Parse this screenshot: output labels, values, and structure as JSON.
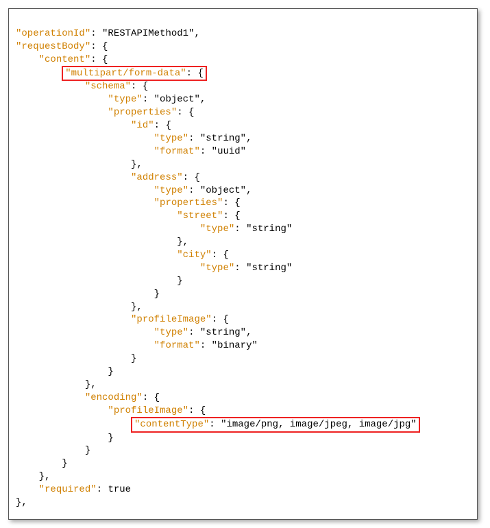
{
  "lines": {
    "l1_k": "\"operationId\"",
    "l1_v": "\"RESTAPIMethod1\"",
    "l2_k": "\"requestBody\"",
    "l3_k": "\"content\"",
    "l4_k": "\"multipart/form-data\"",
    "l5_k": "\"schema\"",
    "l6_k": "\"type\"",
    "l6_v": "\"object\"",
    "l7_k": "\"properties\"",
    "l8_k": "\"id\"",
    "l9_k": "\"type\"",
    "l9_v": "\"string\"",
    "l10_k": "\"format\"",
    "l10_v": "\"uuid\"",
    "l12_k": "\"address\"",
    "l13_k": "\"type\"",
    "l13_v": "\"object\"",
    "l14_k": "\"properties\"",
    "l15_k": "\"street\"",
    "l16_k": "\"type\"",
    "l16_v": "\"string\"",
    "l18_k": "\"city\"",
    "l19_k": "\"type\"",
    "l19_v": "\"string\"",
    "l23_k": "\"profileImage\"",
    "l24_k": "\"type\"",
    "l24_v": "\"string\"",
    "l25_k": "\"format\"",
    "l25_v": "\"binary\"",
    "l29_k": "\"encoding\"",
    "l30_k": "\"profileImage\"",
    "l31_k": "\"contentType\"",
    "l31_v": "\"image/png, image/jpeg, image/jpg\"",
    "l36_k": "\"required\"",
    "l36_v": "true"
  },
  "brace_open": "{",
  "brace_close": "}",
  "colon": ": ",
  "comma": ","
}
